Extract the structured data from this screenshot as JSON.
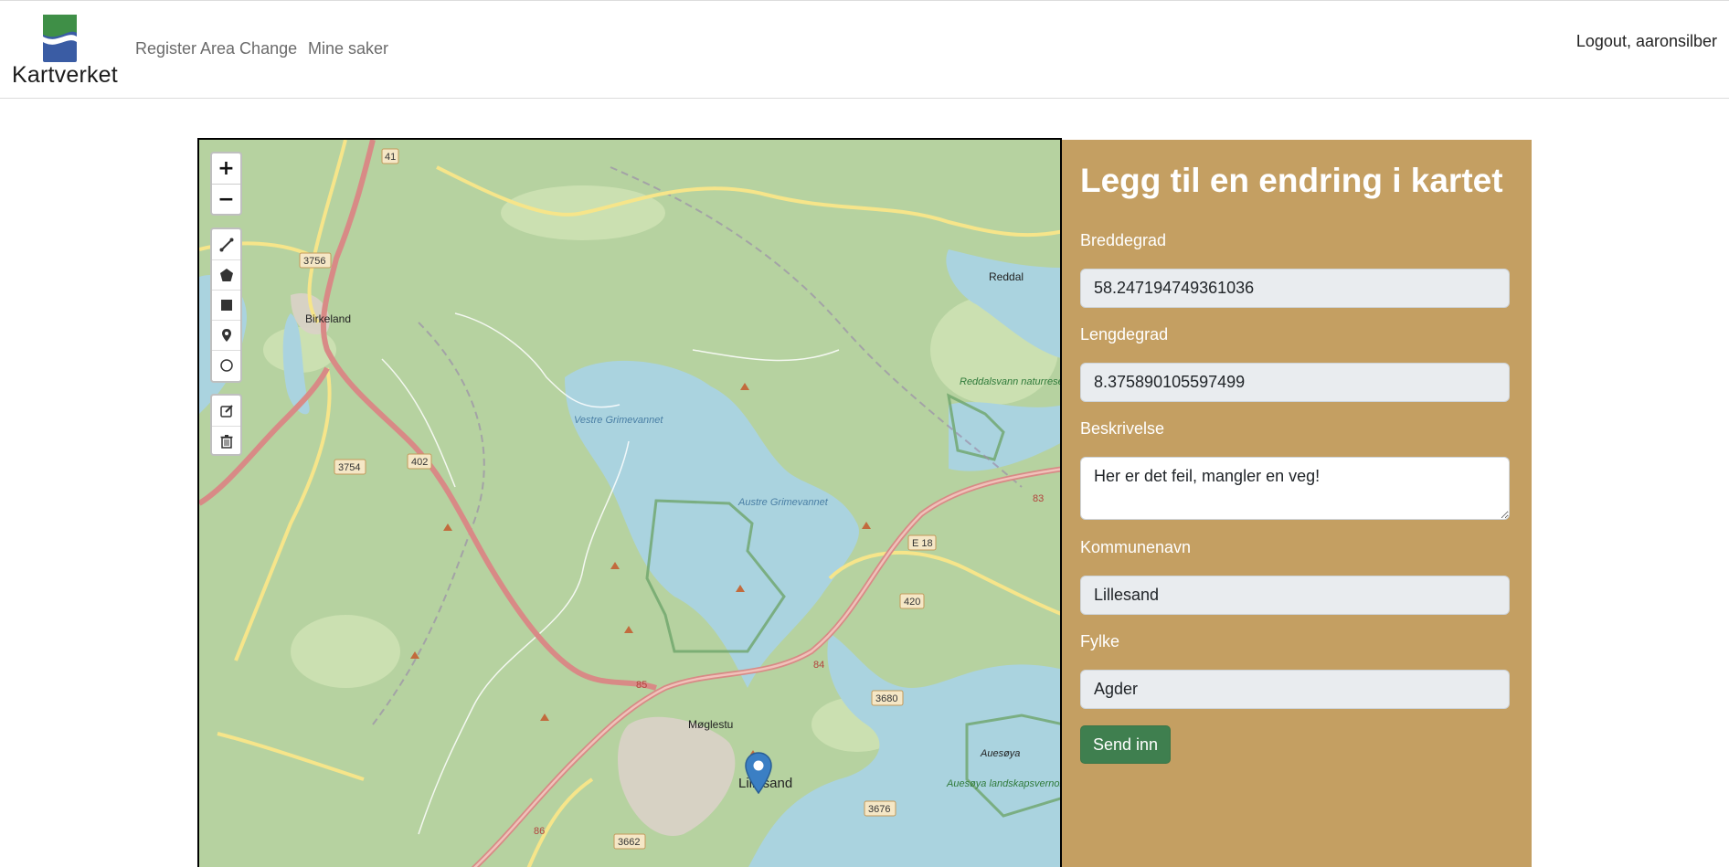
{
  "navbar": {
    "brand_text": "Kartverket",
    "links": [
      "Register Area Change",
      "Mine saker"
    ],
    "logout_label": "Logout, aaronsilber"
  },
  "map": {
    "zoom_in_label": "+",
    "zoom_out_label": "−",
    "place_labels": [
      "Birkeland",
      "Reddal",
      "Vestre Grimevannet",
      "Austre Grimevannet",
      "Reddalsvann naturreservat",
      "Møglestu",
      "Lillesand",
      "Auesøya",
      "Auesøya landskapsvernområde"
    ],
    "road_labels": [
      "41",
      "3756",
      "3754",
      "402",
      "E 18",
      "420",
      "85",
      "84",
      "3680",
      "3676",
      "3662",
      "86",
      "83"
    ],
    "draw_tools": [
      "polyline",
      "polygon",
      "rectangle",
      "marker",
      "circle"
    ],
    "edit_tools": [
      "edit-layers",
      "delete-layers"
    ],
    "colors": {
      "land": "#b6d2a0",
      "water": "#aad3df",
      "road_primary": "#e8a89b",
      "road_secondary": "#f6e58a"
    }
  },
  "form": {
    "title": "Legg til en endring i kartet",
    "latitude": {
      "label": "Breddegrad",
      "value": "58.247194749361036"
    },
    "longitude": {
      "label": "Lengdegrad",
      "value": "8.375890105597499"
    },
    "description": {
      "label": "Beskrivelse",
      "value": "Her er det feil, mangler en veg!"
    },
    "municipality": {
      "label": "Kommunenavn",
      "value": "Lillesand"
    },
    "county": {
      "label": "Fylke",
      "value": "Agder"
    },
    "submit_label": "Send inn",
    "colors": {
      "panel": "#c49f62",
      "submit": "#3f7f4f"
    }
  }
}
